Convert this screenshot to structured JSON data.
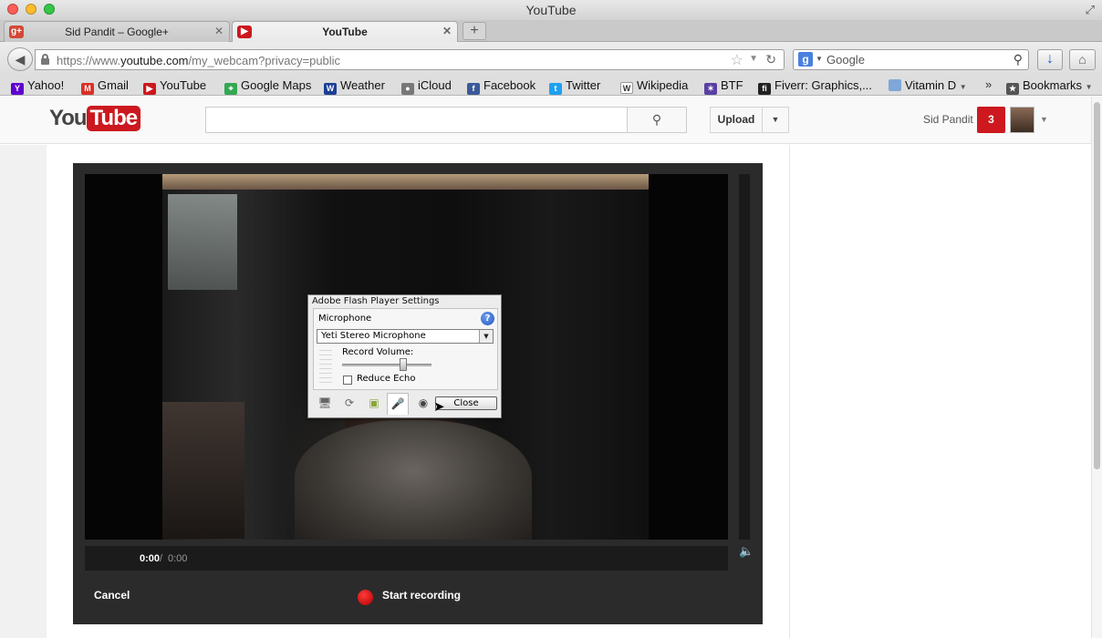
{
  "window": {
    "title": "YouTube"
  },
  "tabs": [
    {
      "label": "Sid Pandit – Google+",
      "favicon": "google-plus-icon",
      "active": false
    },
    {
      "label": "YouTube",
      "favicon": "youtube-icon",
      "active": true
    }
  ],
  "address_bar": {
    "url_scheme": "https://www.",
    "url_host": "youtube.com",
    "url_path": "/my_webcam?privacy=public"
  },
  "search_bar": {
    "placeholder": "Google"
  },
  "bookmarks": [
    {
      "label": "Yahoo!",
      "icon": "yahoo-icon",
      "color": "#5f01d1"
    },
    {
      "label": "Gmail",
      "icon": "gmail-icon",
      "color": "#d93025"
    },
    {
      "label": "YouTube",
      "icon": "youtube-icon",
      "color": "#cc181e"
    },
    {
      "label": "Google Maps",
      "icon": "maps-icon",
      "color": "#34a853"
    },
    {
      "label": "Weather",
      "icon": "twc-icon",
      "color": "#1c3f94"
    },
    {
      "label": "iCloud",
      "icon": "apple-icon",
      "color": "#777777"
    },
    {
      "label": "Facebook",
      "icon": "facebook-icon",
      "color": "#3b5998"
    },
    {
      "label": "Twitter",
      "icon": "twitter-icon",
      "color": "#1da1f2"
    },
    {
      "label": "Wikipedia",
      "icon": "wikipedia-icon",
      "color": "#333333"
    },
    {
      "label": "BTF",
      "icon": "btf-icon",
      "color": "#5a3fa3"
    },
    {
      "label": "Fiverr: Graphics,...",
      "icon": "fiverr-icon",
      "color": "#222222"
    },
    {
      "label": "Vitamin D",
      "icon": "folder-icon",
      "color": "#7fa7d8"
    },
    {
      "label": "Bookmarks",
      "icon": "bookmarks-icon",
      "color": "#555555"
    }
  ],
  "youtube": {
    "logo_you": "You",
    "logo_tube": "Tube",
    "upload_label": "Upload",
    "user_name": "Sid Pandit",
    "notification_count": "3",
    "brand_color": "#cc181e"
  },
  "recorder": {
    "time_current": "0:00",
    "time_separator": "/",
    "time_total": "0:00",
    "cancel_label": "Cancel",
    "record_label": "Start recording"
  },
  "flash_dialog": {
    "title": "Adobe Flash Player Settings",
    "section": "Microphone",
    "help": "?",
    "mic_selected": "Yeti Stereo Microphone",
    "volume_label": "Record Volume:",
    "record_volume": 0.68,
    "echo_label": "Reduce Echo",
    "echo_checked": false,
    "close_label": "Close",
    "tabs": [
      "privacy-icon",
      "local-storage-icon",
      "storage-icon",
      "microphone-icon",
      "camera-icon"
    ],
    "active_tab": 3
  }
}
